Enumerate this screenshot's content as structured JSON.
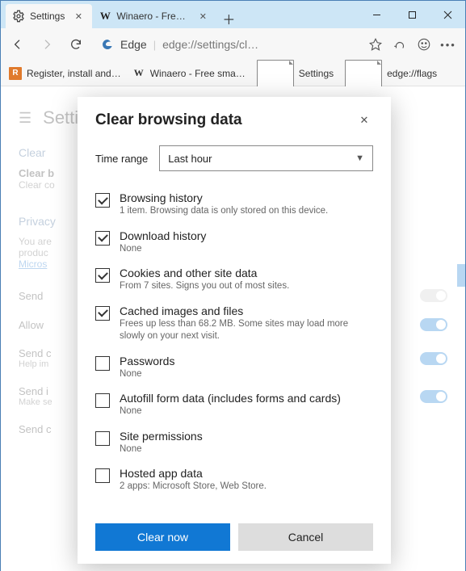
{
  "tabs": [
    {
      "label": "Settings",
      "favicon": "gear"
    },
    {
      "label": "Winaero - Free smal…",
      "favicon": "W"
    }
  ],
  "address": {
    "product": "Edge",
    "url": "edge://settings/cl…"
  },
  "bookmarks": [
    {
      "label": "Register, install and…",
      "icon": "orange"
    },
    {
      "label": "Winaero - Free sma…",
      "icon": "W"
    },
    {
      "label": "Settings",
      "icon": "page"
    },
    {
      "label": "edge://flags",
      "icon": "page"
    }
  ],
  "page": {
    "title": "Settings",
    "sections": {
      "clear": "Clear",
      "clear_sub_title": "Clear b",
      "clear_sub_desc": "Clear co",
      "privacy": "Privacy",
      "privacy_text_1": "You are",
      "privacy_text_2": "produc",
      "privacy_link": "Micros",
      "rows": [
        {
          "t": "Send",
          "d": ""
        },
        {
          "t": "Allow",
          "d": ""
        },
        {
          "t": "Send c",
          "d": "Help im"
        },
        {
          "t": "Send i",
          "d": "Make se"
        },
        {
          "t": "Send c",
          "d": ""
        }
      ]
    }
  },
  "dialog": {
    "title": "Clear browsing data",
    "time_label": "Time range",
    "time_value": "Last hour",
    "items": [
      {
        "checked": true,
        "title": "Browsing history",
        "desc": "1 item. Browsing data is only stored on this device."
      },
      {
        "checked": true,
        "title": "Download history",
        "desc": "None"
      },
      {
        "checked": true,
        "title": "Cookies and other site data",
        "desc": "From 7 sites. Signs you out of most sites."
      },
      {
        "checked": true,
        "title": "Cached images and files",
        "desc": "Frees up less than 68.2 MB. Some sites may load more slowly on your next visit."
      },
      {
        "checked": false,
        "title": "Passwords",
        "desc": "None"
      },
      {
        "checked": false,
        "title": "Autofill form data (includes forms and cards)",
        "desc": "None"
      },
      {
        "checked": false,
        "title": "Site permissions",
        "desc": "None"
      },
      {
        "checked": false,
        "title": "Hosted app data",
        "desc": "2 apps: Microsoft Store, Web Store."
      }
    ],
    "clear_btn": "Clear now",
    "cancel_btn": "Cancel"
  }
}
